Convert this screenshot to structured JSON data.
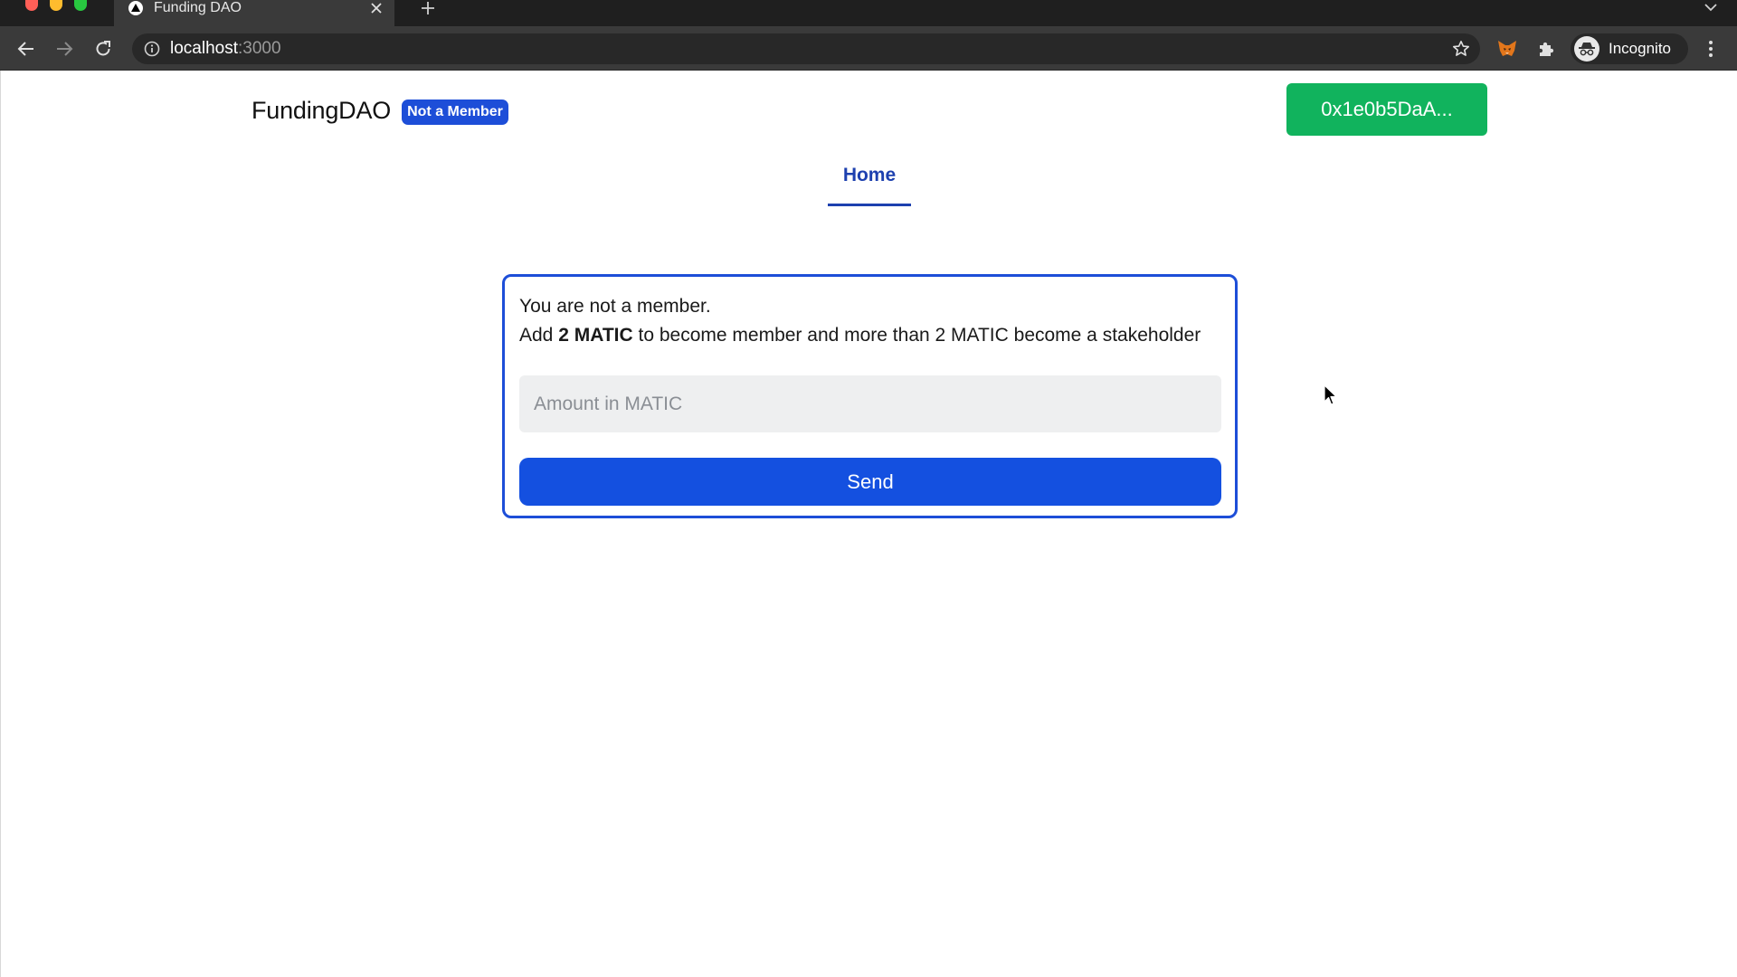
{
  "browser": {
    "tab_title": "Funding DAO",
    "url_host": "localhost",
    "url_port": ":3000",
    "profile_label": "Incognito"
  },
  "header": {
    "brand_title": "FundingDAO",
    "membership_badge": "Not a Member",
    "wallet_address": "0x1e0b5DaA..."
  },
  "nav": {
    "tabs": [
      {
        "label": "Home",
        "active": true
      }
    ]
  },
  "membership_card": {
    "status_text": "You are not a member.",
    "instruction_prefix": "Add",
    "instruction_amount": "2 MATIC",
    "instruction_suffix": "to become member and more than 2 MATIC become a stakeholder",
    "amount_input": {
      "value": "",
      "placeholder": "Amount in MATIC"
    },
    "send_label": "Send"
  },
  "colors": {
    "accent_blue": "#1d4ed8",
    "send_blue": "#1450e0",
    "wallet_green": "#11b35d",
    "nav_active": "#1d40af"
  }
}
